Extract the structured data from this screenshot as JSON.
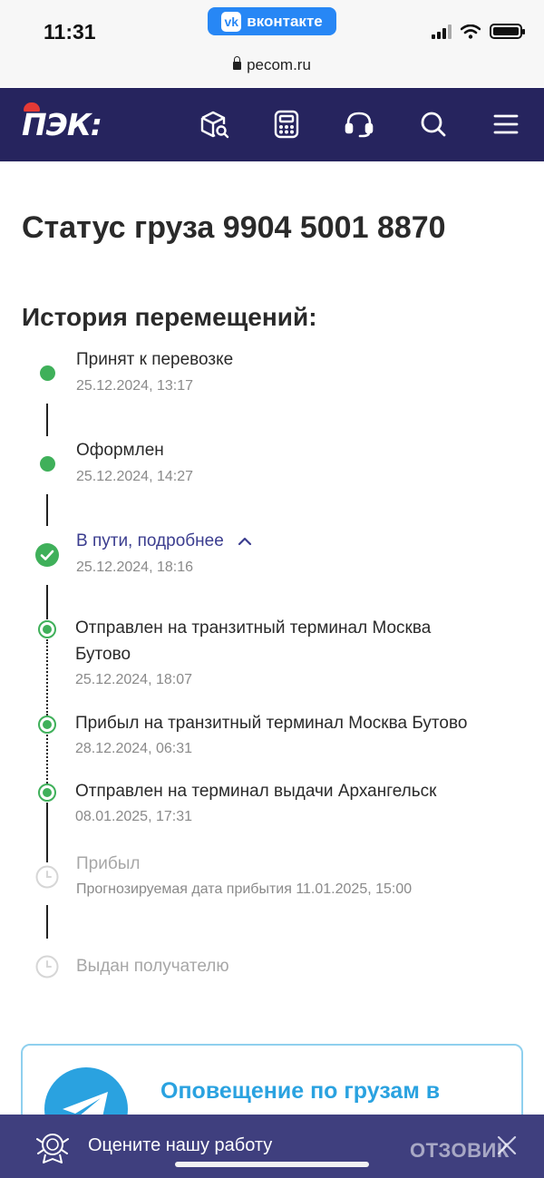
{
  "status_bar": {
    "time": "11:31",
    "app_pill": "вконтакте",
    "url": "pecom.ru"
  },
  "header": {
    "logo_text": "ПЭК:",
    "nav_icons": [
      "package-search-icon",
      "calculator-icon",
      "headset-icon",
      "search-icon",
      "menu-icon"
    ]
  },
  "page": {
    "title": "Статус груза 9904 5001 8870",
    "history_title": "История перемещений:"
  },
  "timeline": {
    "steps": [
      {
        "label": "Принят к перевозке",
        "date": "25.12.2024, 13:17"
      },
      {
        "label": "Оформлен",
        "date": "25.12.2024, 14:27"
      },
      {
        "label": "В пути, подробнее",
        "date": "25.12.2024, 18:16"
      }
    ],
    "substeps": [
      {
        "label_line1": "Отправлен на транзитный терминал Москва",
        "label_line2": "Бутово",
        "date": "25.12.2024, 18:07"
      },
      {
        "label": "Прибыл на транзитный терминал Москва Бутово",
        "date": "28.12.2024, 06:31"
      },
      {
        "label": "Отправлен на терминал выдачи Архангельск",
        "date": "08.01.2025, 17:31"
      }
    ],
    "pending": [
      {
        "label": "Прибыл",
        "note": "Прогнозируемая дата прибытия 11.01.2025, 15:00"
      },
      {
        "label": "Выдан получателю"
      }
    ]
  },
  "notification_card": {
    "title": "Оповещение по грузам в"
  },
  "rating_bar": {
    "text": "Оцените нашу работу"
  },
  "watermark": "ОТЗОВИК",
  "colors": {
    "navbar": "#26245e",
    "done_green": "#3fb05a",
    "link": "#3b3d8f",
    "telegram_blue": "#2aa2e0",
    "rating_bar": "#3f3f7e"
  }
}
